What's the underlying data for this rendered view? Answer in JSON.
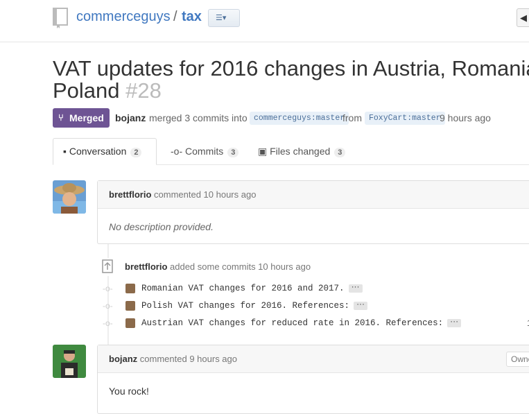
{
  "header": {
    "owner": "commerceguys",
    "separator": "/",
    "repo": "tax",
    "list_icon": "☰▾",
    "right_icon": "◀"
  },
  "pr": {
    "title_line1": "VAT updates for 2016 changes in Austria, Romania,",
    "title_line2": "Poland",
    "number": "#28",
    "state": "Merged",
    "merger": "bojanz",
    "merged_text": "merged 3 commits into",
    "base_branch": "commerceguys:master",
    "from_text": "from",
    "head_branch": "FoxyCart:master",
    "time": "9 hours ago"
  },
  "tabs": [
    {
      "label": "Conversation",
      "count": "2"
    },
    {
      "label": "Commits",
      "count": "3"
    },
    {
      "label": "Files changed",
      "count": "3"
    }
  ],
  "comment1": {
    "author": "brettflorio",
    "action": "commented 10 hours ago",
    "body": "No description provided."
  },
  "push_event": {
    "author": "brettflorio",
    "action": "added some commits 10 hours ago"
  },
  "commits": [
    {
      "message": "Romanian VAT changes for 2016 and 2017.",
      "ellipsis": "···"
    },
    {
      "message": "Polish VAT changes for 2016. References:",
      "ellipsis": "···"
    },
    {
      "message": "Austrian VAT changes for reduced rate in 2016. References:",
      "ellipsis": "···",
      "tail": "1"
    }
  ],
  "comment2": {
    "author": "bojanz",
    "action": "commented 9 hours ago",
    "badge": "Owne",
    "body": "You rock!"
  },
  "colors": {
    "link": "#4078c0",
    "merged": "#6e5494"
  }
}
